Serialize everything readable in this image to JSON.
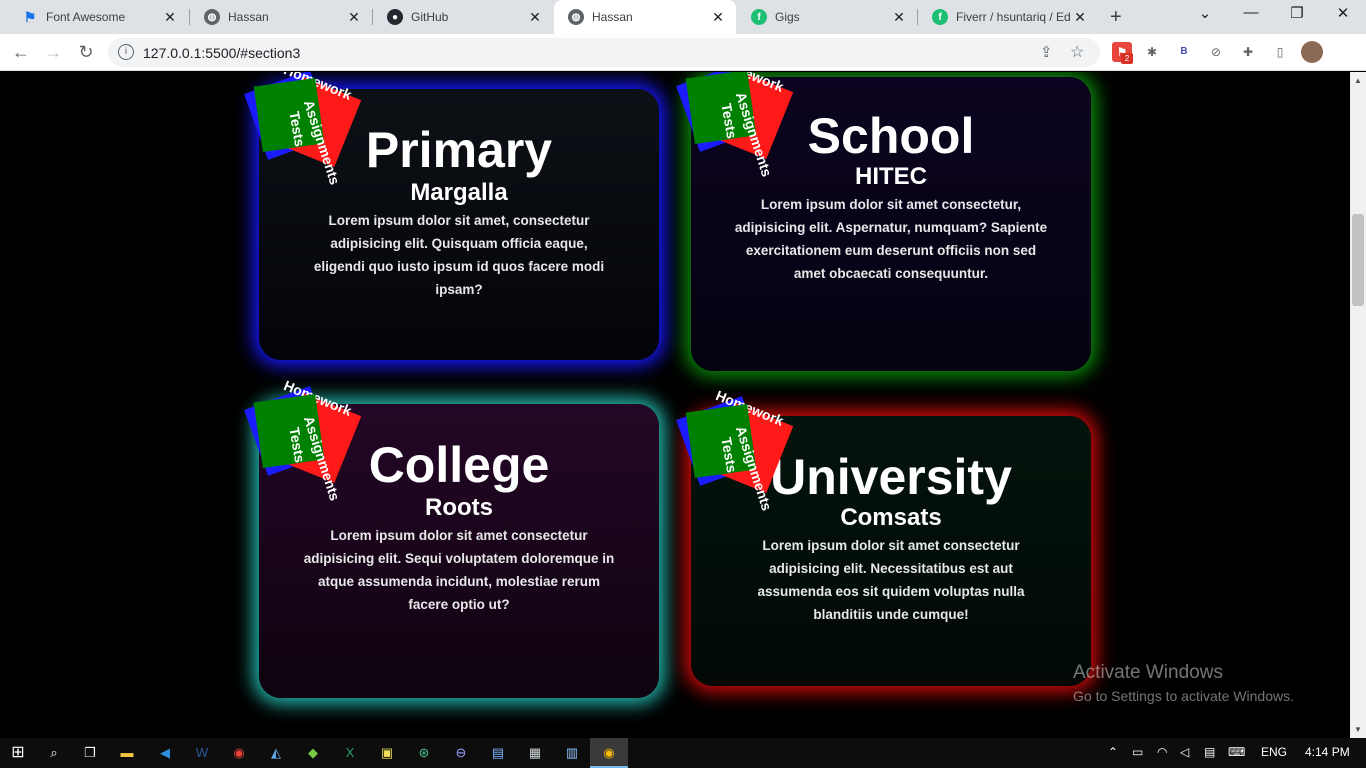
{
  "browser": {
    "tabs": [
      {
        "title": "Font Awesome",
        "icon": "flag-icon",
        "active": false
      },
      {
        "title": "Hassan",
        "icon": "globe-icon",
        "active": false
      },
      {
        "title": "GitHub",
        "icon": "github-icon",
        "active": false
      },
      {
        "title": "Hassan",
        "icon": "globe-icon",
        "active": true
      },
      {
        "title": "Gigs",
        "icon": "fiverr-icon",
        "active": false
      },
      {
        "title": "Fiverr / hsuntariq / Ed",
        "icon": "fiverr-icon",
        "active": false
      }
    ],
    "address": "127.0.0.1:5500/#section3",
    "extension_badge": "2"
  },
  "cards": [
    {
      "title": "Primary",
      "subtitle": "Margalla",
      "description": "Lorem ipsum dolor sit amet, consectetur adipisicing elit. Quisquam officia eaque, eligendi quo iusto ipsum id quos facere modi ipsam?",
      "glow": "#1818ff"
    },
    {
      "title": "School",
      "subtitle": "HITEC",
      "description": "Lorem ipsum dolor sit amet consectetur, adipisicing elit. Aspernatur, numquam? Sapiente exercitationem eum deserunt officiis non sed amet obcaecati consequuntur.",
      "glow": "#0b8a0b"
    },
    {
      "title": "College",
      "subtitle": "Roots",
      "description": "Lorem ipsum dolor sit amet consectetur adipisicing elit. Sequi voluptatem doloremque in atque assumenda incidunt, molestiae rerum facere optio ut?",
      "glow": "#24b7ad"
    },
    {
      "title": "University",
      "subtitle": "Comsats",
      "description": "Lorem ipsum dolor sit amet consectetur adipisicing elit. Necessitatibus est aut assumenda eos sit quidem voluptas nulla blanditiis unde cumque!",
      "glow": "#d20a0a"
    }
  ],
  "note_labels": {
    "homework": "Homework",
    "tests": "Tests",
    "assignments": "Assignments"
  },
  "watermark": {
    "title": "Activate Windows",
    "subtitle": "Go to Settings to activate Windows."
  },
  "taskbar": {
    "language": "ENG",
    "time": "4:14 PM"
  }
}
